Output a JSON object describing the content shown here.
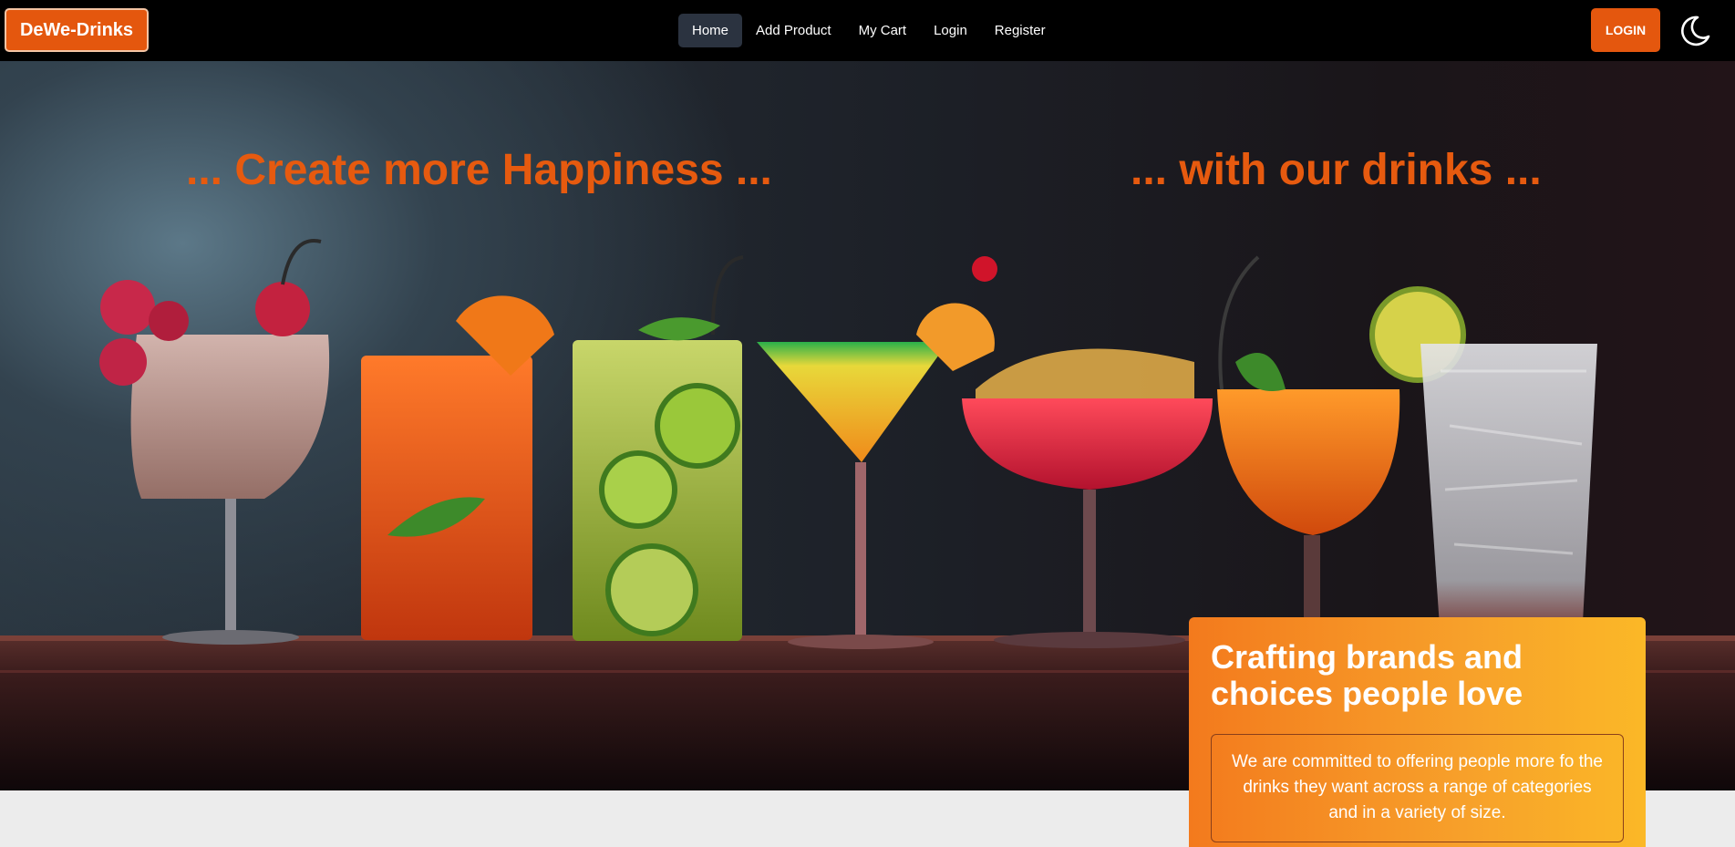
{
  "brand": {
    "label": "DeWe-Drinks"
  },
  "nav": {
    "items": [
      {
        "label": "Home",
        "active": true
      },
      {
        "label": "Add Product"
      },
      {
        "label": "My Cart"
      },
      {
        "label": "Login"
      },
      {
        "label": "Register"
      }
    ]
  },
  "header": {
    "login_label": "LOGIN",
    "theme_icon": "moon-icon"
  },
  "hero": {
    "headline_left": "... Create more Happiness ...",
    "headline_right": "... with our drinks ...",
    "image": "cocktail-glasses-image"
  },
  "card": {
    "title": "Crafting brands and choices people love",
    "text": "We are committed to offering people more fo the drinks they want across a range of categories and in a variety of size."
  },
  "colors": {
    "accent": "#e4570e",
    "navbar": "#000000",
    "card_gradient_start": "#f37a1d",
    "card_gradient_end": "#fbb827"
  }
}
